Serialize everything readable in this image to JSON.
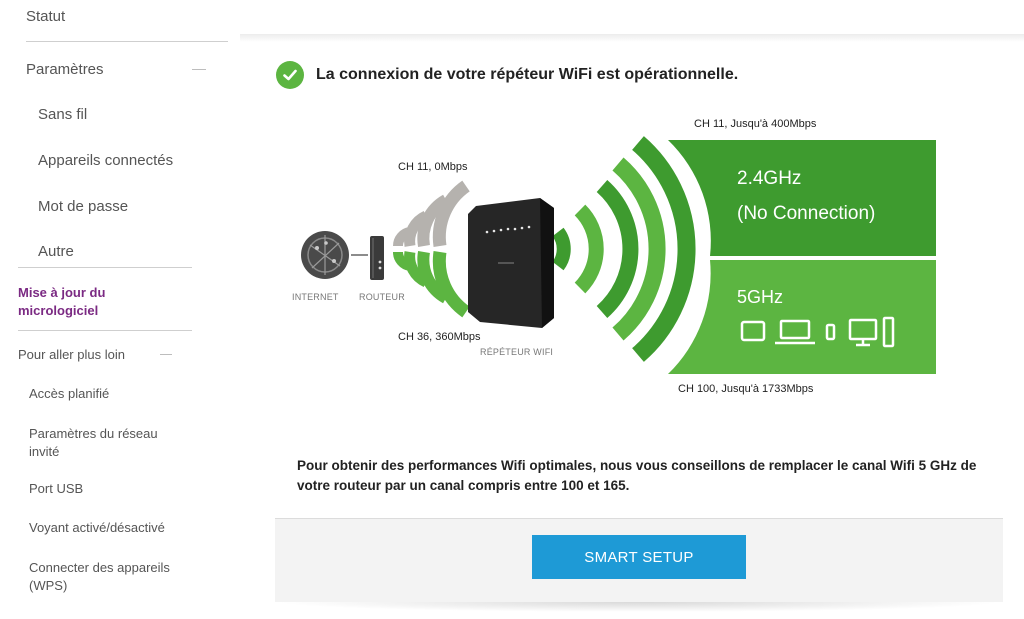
{
  "sidebar": {
    "statut": "Statut",
    "parametres": "Paramètres",
    "sans_fil": "Sans fil",
    "appareils_connectes": "Appareils connectés",
    "mot_de_passe": "Mot de passe",
    "autre": "Autre",
    "mise_a_jour": "Mise à jour du micrologiciel",
    "pour_aller_plus_loin": "Pour aller plus loin",
    "acces_planifie": "Accès planifié",
    "parametres_reseau_invite": "Paramètres du réseau invité",
    "port_usb": "Port USB",
    "voyant": "Voyant activé/désactivé",
    "wps": "Connecter des appareils (WPS)"
  },
  "status": {
    "message": "La connexion de votre répéteur WiFi est opérationnelle."
  },
  "diagram": {
    "uplink_24": "CH 11, 0Mbps",
    "uplink_5": "CH 36, 360Mbps",
    "internet": "INTERNET",
    "routeur": "ROUTEUR",
    "repeteur": "RÉPÉTEUR WIFI",
    "band24_top_label": "CH 11, Jusqu'à 400Mbps",
    "band24_name": "2.4GHz",
    "band24_status": "(No Connection)",
    "band5_name": "5GHz",
    "band5_bottom_label": "CH 100, Jusqu'à 1733Mbps"
  },
  "advice": "Pour obtenir des performances Wifi optimales, nous vous conseillons de remplacer le canal Wifi 5 GHz de votre routeur par un canal compris entre 100 et 165.",
  "buttons": {
    "smart_setup": "SMART SETUP"
  },
  "colors": {
    "green_dark": "#3e9b2f",
    "green_light": "#5cb541",
    "grey_wave": "#b5b2ae",
    "accent_blue": "#1e9ad6",
    "active_purple": "#7b2a83"
  }
}
